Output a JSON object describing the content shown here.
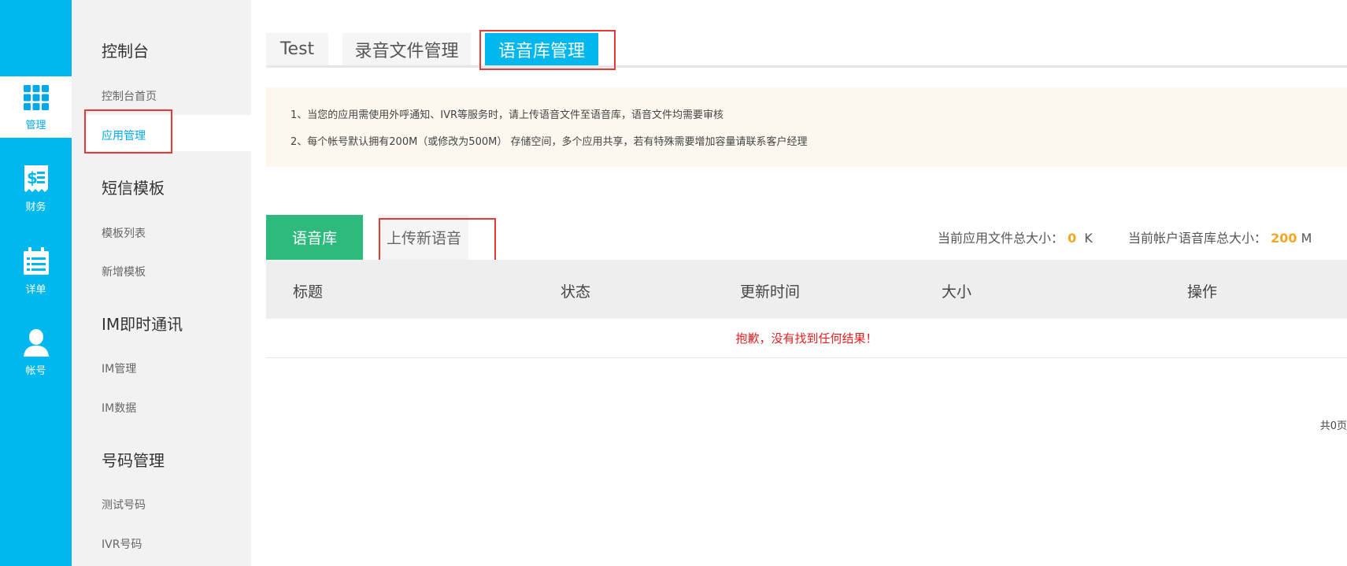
{
  "rail": {
    "items": [
      {
        "label": "管理",
        "icon": "grid-icon",
        "active": true
      },
      {
        "label": "财务",
        "icon": "finance-icon",
        "active": false
      },
      {
        "label": "详单",
        "icon": "calendar-list-icon",
        "active": false
      },
      {
        "label": "帐号",
        "icon": "user-icon",
        "active": false
      }
    ]
  },
  "sidebar": {
    "sections": [
      {
        "title": "控制台",
        "items": [
          "控制台首页",
          "应用管理"
        ]
      },
      {
        "title": "短信模板",
        "items": [
          "模板列表",
          "新增模板"
        ]
      },
      {
        "title": "IM即时通讯",
        "items": [
          "IM管理",
          "IM数据"
        ]
      },
      {
        "title": "号码管理",
        "items": [
          "测试号码",
          "IVR号码"
        ]
      }
    ],
    "active_item": "应用管理"
  },
  "tabs": [
    {
      "label": "Test",
      "active": false
    },
    {
      "label": "录音文件管理",
      "active": false
    },
    {
      "label": "语音库管理",
      "active": true
    }
  ],
  "notice": {
    "line1": "1、当您的应用需使用外呼通知、IVR等服务时，请上传语音文件至语音库，语音文件均需要审核",
    "line2": "2、每个帐号默认拥有200M（或修改为500M） 存储空间，多个应用共享，若有特殊需要增加容量请联系客户经理"
  },
  "subtabs": {
    "library": "语音库",
    "upload": "上传新语音"
  },
  "stats": {
    "app_label": "当前应用文件总大小：",
    "app_value": "0",
    "app_unit": "K",
    "account_label": "当前帐户语音库总大小：",
    "account_value": "200",
    "account_unit": "M"
  },
  "table": {
    "headers": [
      "标题",
      "状态",
      "更新时间",
      "大小",
      "操作"
    ],
    "empty_message": "抱歉，没有找到任何结果！"
  },
  "pager": {
    "text": "共0页"
  },
  "colors": {
    "brand": "#00b7ee",
    "green": "#2dba7c",
    "highlight": "#f5a623",
    "error": "#e02020",
    "annotation": "#e53935"
  }
}
